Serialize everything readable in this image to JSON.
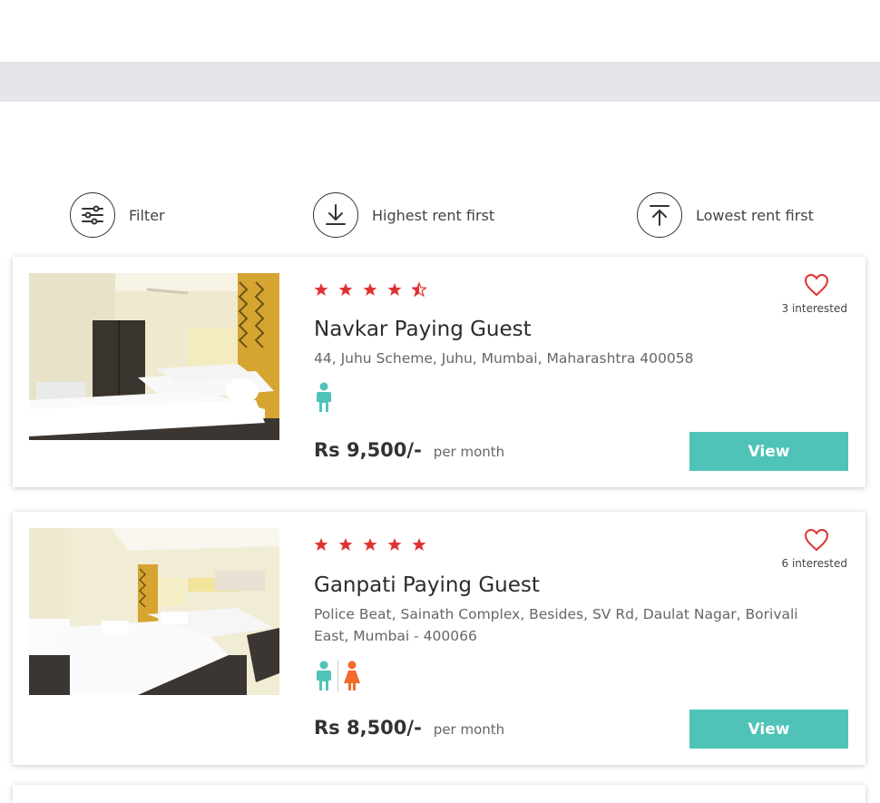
{
  "sort_options": [
    {
      "label": "Filter",
      "icon": "filter-icon"
    },
    {
      "label": "Highest rent first",
      "icon": "sort-desc-icon"
    },
    {
      "label": "Lowest rent first",
      "icon": "sort-asc-icon"
    }
  ],
  "listings": [
    {
      "name": "Navkar Paying Guest",
      "address": "44, Juhu Scheme, Juhu, Mumbai, Maharashtra 400058",
      "rating": 4.5,
      "interested": "3 interested",
      "price": "Rs 9,500/-",
      "price_unit": "per month",
      "gender": [
        "male"
      ],
      "view_label": "View"
    },
    {
      "name": "Ganpati Paying Guest",
      "address": "Police Beat, Sainath Complex, Besides, SV Rd, Daulat Nagar, Borivali East, Mumbai - 400066",
      "rating": 5,
      "interested": "6 interested",
      "price": "Rs 8,500/-",
      "price_unit": "per month",
      "gender": [
        "male",
        "female"
      ],
      "view_label": "View"
    }
  ],
  "colors": {
    "accent": "#4fc3b8",
    "star": "#e03131",
    "heart": "#e03131",
    "male": "#4fc3b8",
    "female": "#f26a2e",
    "band": "#e6e5ea"
  }
}
